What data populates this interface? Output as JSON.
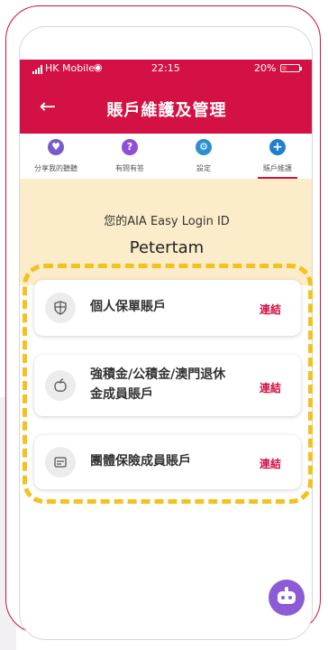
{
  "status_bar": {
    "carrier": "HK Mobile",
    "time": "22:15",
    "battery": "20%"
  },
  "header": {
    "title": "賬戶維護及管理"
  },
  "tabs": [
    {
      "label": "分享我的聽聽",
      "icon": "share-icon",
      "color": "#7a5cc9"
    },
    {
      "label": "有問有答",
      "icon": "faq-icon",
      "color": "#8d4ed8"
    },
    {
      "label": "設定",
      "icon": "gear-icon",
      "color": "#2c8fd4"
    },
    {
      "label": "賬戶維護",
      "icon": "plus-icon",
      "color": "#1f7fd0",
      "active": true
    }
  ],
  "login": {
    "label": "您的AIA Easy Login ID",
    "value": "Petertam"
  },
  "accounts": [
    {
      "icon": "shield-icon",
      "label_line1": "個人保單賬戶",
      "label_line2": "",
      "link": "連結"
    },
    {
      "icon": "apple-icon",
      "label_line1": "強積金/公積金/澳門退休",
      "label_line2": "金成員賬戶",
      "link": "連結"
    },
    {
      "icon": "card-icon",
      "label_line1": "團體保險成員賬戶",
      "label_line2": "",
      "link": "連結"
    }
  ],
  "colors": {
    "brand": "#d31145",
    "highlight": "#f4c21e",
    "login_bg": "#fbedc9",
    "chatbot": "#8c5bd6"
  }
}
